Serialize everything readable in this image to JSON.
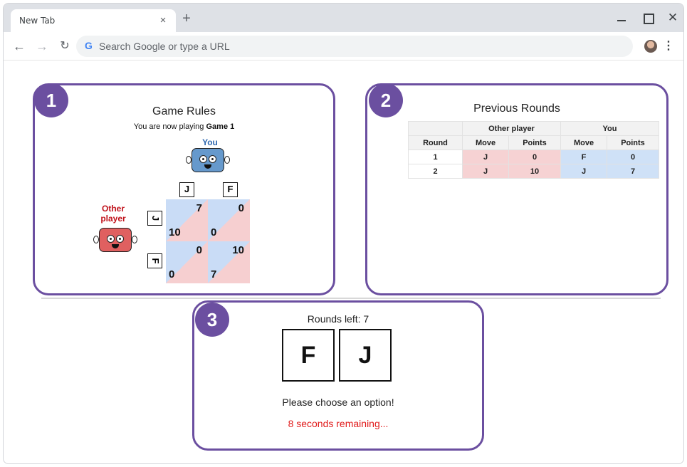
{
  "browser": {
    "tab_title": "New Tab",
    "tab_close": "×",
    "new_tab": "+",
    "omnibox_placeholder": "Search Google or type a URL",
    "google_glyph": "G",
    "menu": "⋮"
  },
  "panel1": {
    "badge": "1",
    "title": "Game Rules",
    "subtitle_prefix": "You are now playing ",
    "subtitle_game": "Game 1",
    "you_label": "You",
    "other_label": "Other player",
    "you_color": "#2e68b0",
    "other_color": "#c0111a",
    "col_keys": [
      "J",
      "F"
    ],
    "row_keys": [
      "J",
      "F"
    ],
    "payoffs": [
      {
        "row": "J",
        "col": "J",
        "you": "7",
        "other": "10"
      },
      {
        "row": "J",
        "col": "F",
        "you": "0",
        "other": "0"
      },
      {
        "row": "F",
        "col": "J",
        "you": "0",
        "other": "0"
      },
      {
        "row": "F",
        "col": "F",
        "you": "10",
        "other": "7"
      }
    ]
  },
  "panel2": {
    "badge": "2",
    "title": "Previous Rounds",
    "group_other": "Other player",
    "group_you": "You",
    "headers": [
      "Round",
      "Move",
      "Points",
      "Move",
      "Points"
    ],
    "rows": [
      [
        "1",
        "J",
        "0",
        "F",
        "0"
      ],
      [
        "2",
        "J",
        "10",
        "J",
        "7"
      ]
    ]
  },
  "panel3": {
    "badge": "3",
    "rounds_left": "Rounds left: 7",
    "option_f": "F",
    "option_j": "J",
    "prompt": "Please choose an option!",
    "timer": "8 seconds remaining..."
  },
  "colors": {
    "accent": "#6b4fa0",
    "you_cell": "#c9dcf6",
    "other_cell": "#f6cfd0",
    "timer": "#e11b1b"
  }
}
